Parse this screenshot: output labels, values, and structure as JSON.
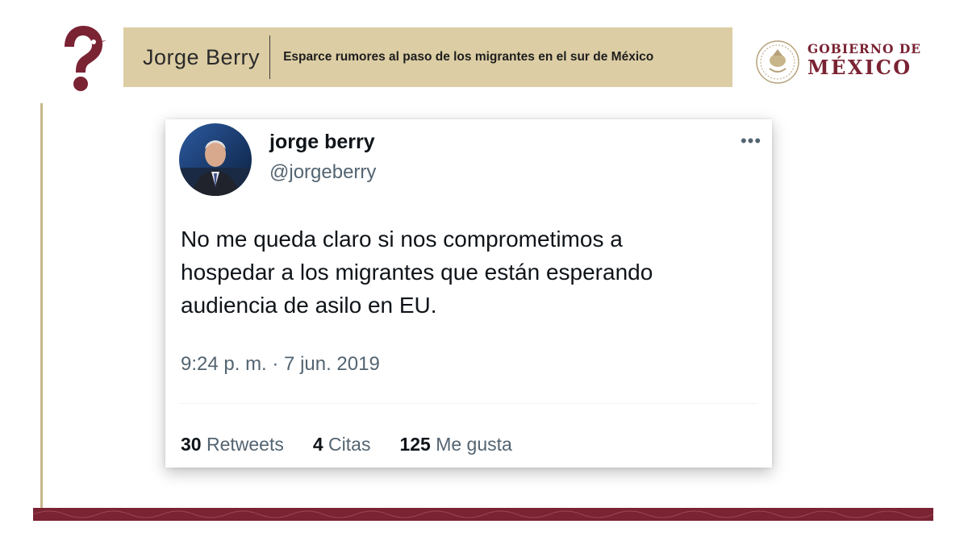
{
  "header": {
    "name": "Jorge Berry",
    "subtitle": "Esparce rumores al paso de los migrantes en el sur de México",
    "question_icon": "question-mark-icon",
    "gov_line1": "GOBIERNO DE",
    "gov_line2": "MÉXICO",
    "seal_icon": "national-seal-icon"
  },
  "tweet": {
    "display_name": "jorge berry",
    "handle": "@jorgeberry",
    "more_icon": "more-icon",
    "more_glyph": "•••",
    "text": "No me queda claro si nos comprometimos a\nhospedar a los migrantes que están esperando\naudiencia de asilo en EU.",
    "timestamp": "9:24 p. m. · 7 jun. 2019",
    "stats": [
      {
        "count": "30",
        "label": "Retweets"
      },
      {
        "count": "4",
        "label": "Citas"
      },
      {
        "count": "125",
        "label": "Me gusta"
      }
    ]
  },
  "colors": {
    "brand_maroon": "#7a2333",
    "header_beige": "#dccda4",
    "rule_gold": "#c8b68a"
  }
}
